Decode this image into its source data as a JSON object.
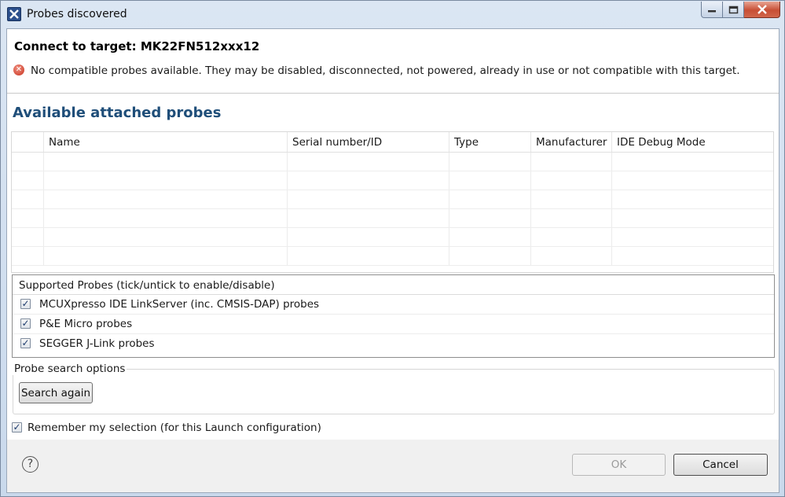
{
  "window": {
    "title": "Probes discovered"
  },
  "header": {
    "title": "Connect to target: MK22FN512xxx12",
    "error_message": "No compatible probes available. They may be disabled, disconnected, not powered, already in use or not compatible with this target.",
    "error_icon": "error-x-icon"
  },
  "probes": {
    "section_title": "Available attached probes",
    "columns": [
      "",
      "Name",
      "Serial number/ID",
      "Type",
      "Manufacturer",
      "IDE Debug Mode"
    ],
    "rows": []
  },
  "supported": {
    "header": "Supported Probes (tick/untick to enable/disable)",
    "items": [
      {
        "label": "MCUXpresso IDE LinkServer (inc. CMSIS-DAP) probes",
        "checked": true
      },
      {
        "label": "P&E Micro probes",
        "checked": true
      },
      {
        "label": "SEGGER J-Link probes",
        "checked": true
      }
    ]
  },
  "search_options": {
    "legend": "Probe search options",
    "search_button": "Search again"
  },
  "remember": {
    "label": "Remember my selection (for this Launch configuration)",
    "checked": true
  },
  "footer": {
    "help_symbol": "?",
    "ok_label": "OK",
    "cancel_label": "Cancel"
  },
  "colors": {
    "section_title": "#1f4e79",
    "error_icon": "#c8321f",
    "close_button": "#c74f35"
  }
}
